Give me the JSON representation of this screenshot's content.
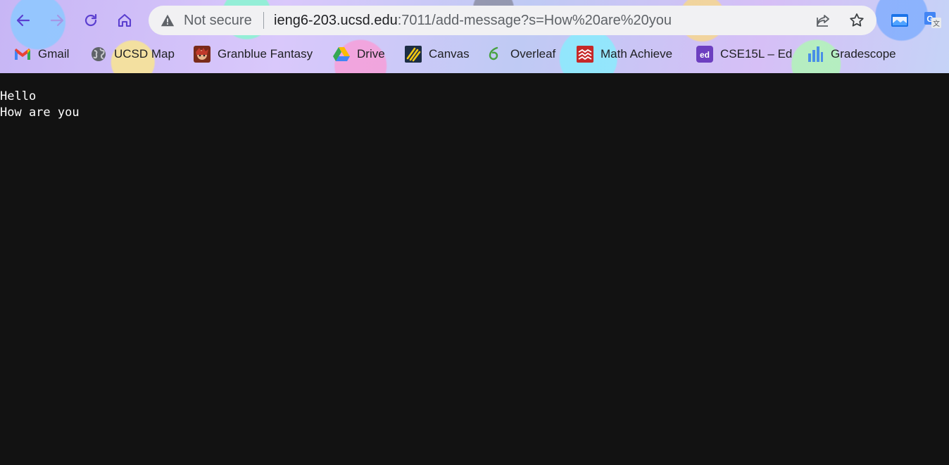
{
  "omnibox": {
    "security_label": "Not secure",
    "url_host": "ieng6-203.ucsd.edu",
    "url_path": ":7011/add-message?s=How%20are%20you"
  },
  "icons": {
    "back": "arrow-left-icon",
    "forward": "arrow-right-icon",
    "reload": "reload-icon",
    "home": "home-icon",
    "warning": "warning-triangle-icon",
    "share": "share-icon",
    "star": "star-icon"
  },
  "bookmarks": [
    {
      "label": "Gmail"
    },
    {
      "label": "UCSD Map"
    },
    {
      "label": "Granblue Fantasy"
    },
    {
      "label": "Drive"
    },
    {
      "label": "Canvas"
    },
    {
      "label": "Overleaf"
    },
    {
      "label": "Math Achieve"
    },
    {
      "label": "CSE15L – Ed"
    },
    {
      "label": "Gradescope"
    }
  ],
  "page": {
    "lines": [
      "Hello",
      "How are you"
    ]
  },
  "colors": {
    "nav_icon": "#5b3fd0",
    "page_background": "#121212",
    "page_text": "#ffffff"
  }
}
